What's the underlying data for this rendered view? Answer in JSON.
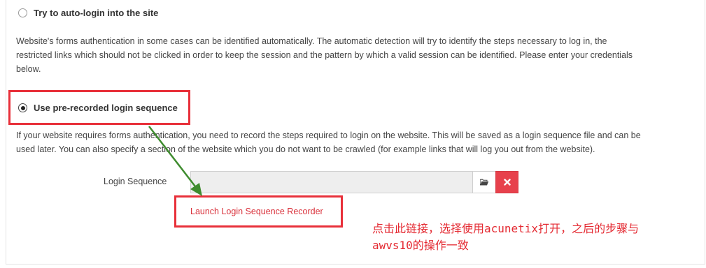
{
  "option_auto": {
    "label": "Try to auto-login into the site",
    "description_lines": [
      "Website's forms authentication in some cases can be identified automatically. The automatic detection will try to identify the steps necessary to log in, the",
      "restricted links which should not be clicked in order to keep the session and the pattern by which a valid session can be identified. Please enter your credentials",
      "below."
    ]
  },
  "option_recorded": {
    "label": "Use pre-recorded login sequence",
    "description_lines": [
      "If your website requires forms authentication, you need to record the steps required to login on the website. This will be saved as a login sequence file and can be",
      "used later. You can also specify a section of the website which you do not want to be crawled (for example links that will log you out from the website)."
    ]
  },
  "login_sequence": {
    "label": "Login Sequence",
    "value": "",
    "browse_icon": "folder-open-icon",
    "clear_icon": "close-icon"
  },
  "recorder_link": {
    "label": "Launch Login Sequence Recorder"
  },
  "annotation": {
    "lines": [
      "点击此链接，选择使用acunetix打开，之后的步骤与",
      "awvs10的操作一致"
    ]
  },
  "colors": {
    "highlight_red": "#e8303a",
    "arrow_green": "#3f8c2f",
    "clear_button": "#e7414c",
    "link_red": "#d9303a"
  }
}
